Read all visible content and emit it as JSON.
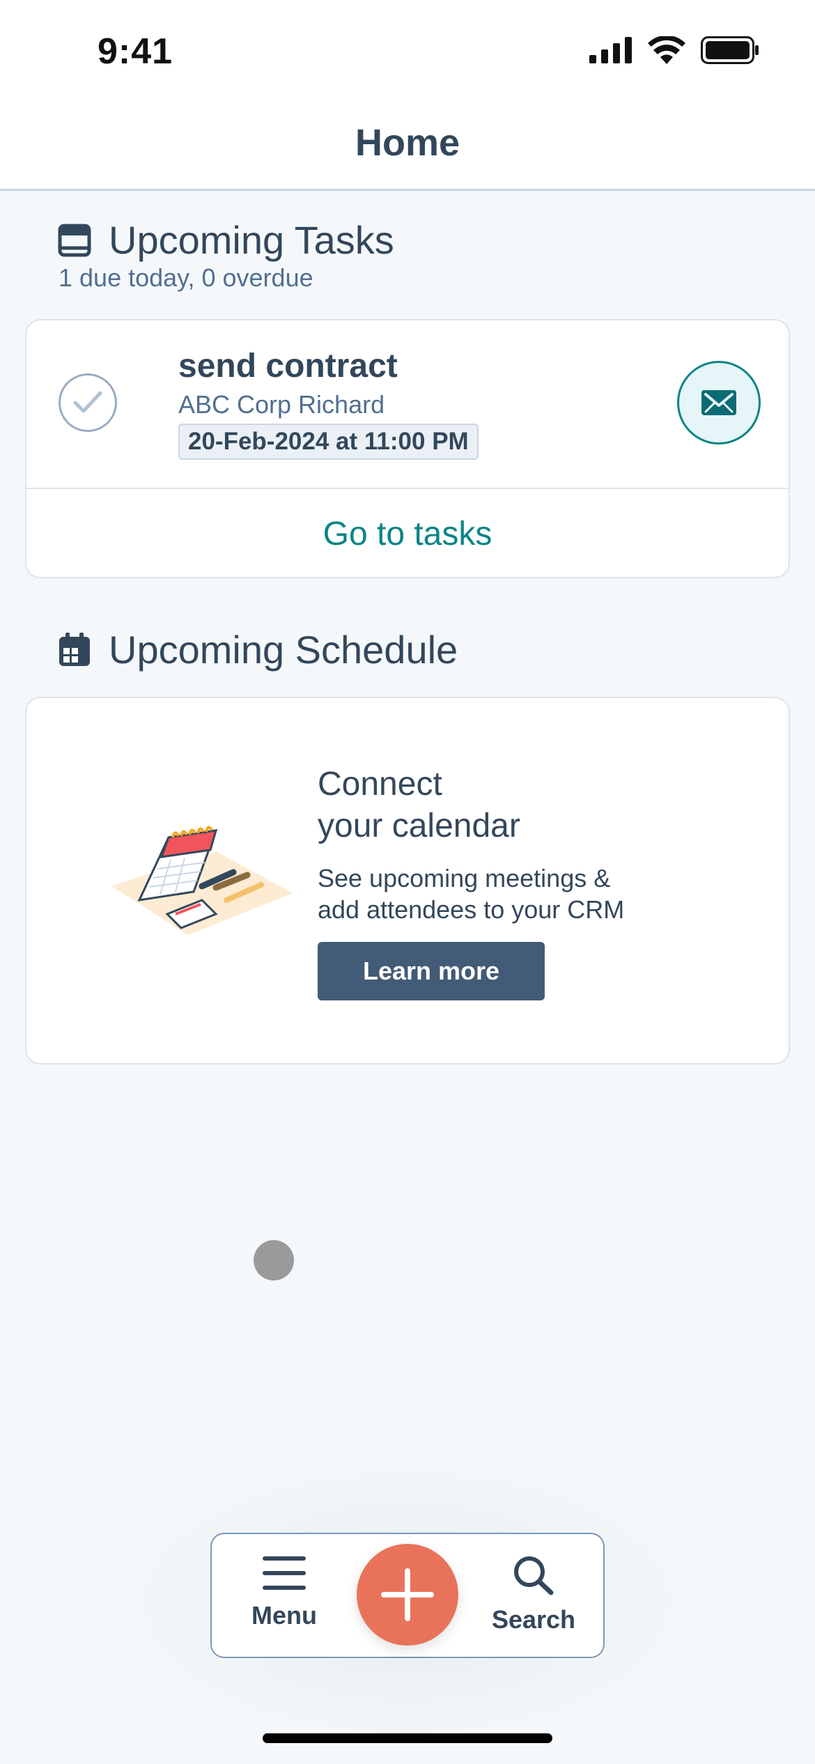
{
  "status_bar": {
    "time": "9:41",
    "icons": [
      "cellular-signal-icon",
      "wifi-icon",
      "battery-icon"
    ]
  },
  "header": {
    "title": "Home"
  },
  "tasks_section": {
    "title": "Upcoming Tasks",
    "subtitle": "1 due today, 0 overdue",
    "icon": "tasks-icon",
    "items": [
      {
        "title": "send contract",
        "company": "ABC Corp Richard",
        "due": "20-Feb-2024 at 11:00 PM",
        "type_icon": "email-icon"
      }
    ],
    "go_to_label": "Go to tasks"
  },
  "schedule_section": {
    "title": "Upcoming Schedule",
    "icon": "calendar-icon",
    "connect_title_line1": "Connect",
    "connect_title_line2": "your calendar",
    "description_line1": "See upcoming meetings &",
    "description_line2": "add attendees to your CRM",
    "button_label": "Learn more"
  },
  "tab_bar": {
    "menu_label": "Menu",
    "search_label": "Search",
    "fab_icon": "plus-icon"
  },
  "colors": {
    "accent_teal": "#0b8484",
    "fab_orange": "#e8735a",
    "button_dark": "#425b76",
    "text_primary": "#33475b",
    "background": "#f5f8fa"
  }
}
